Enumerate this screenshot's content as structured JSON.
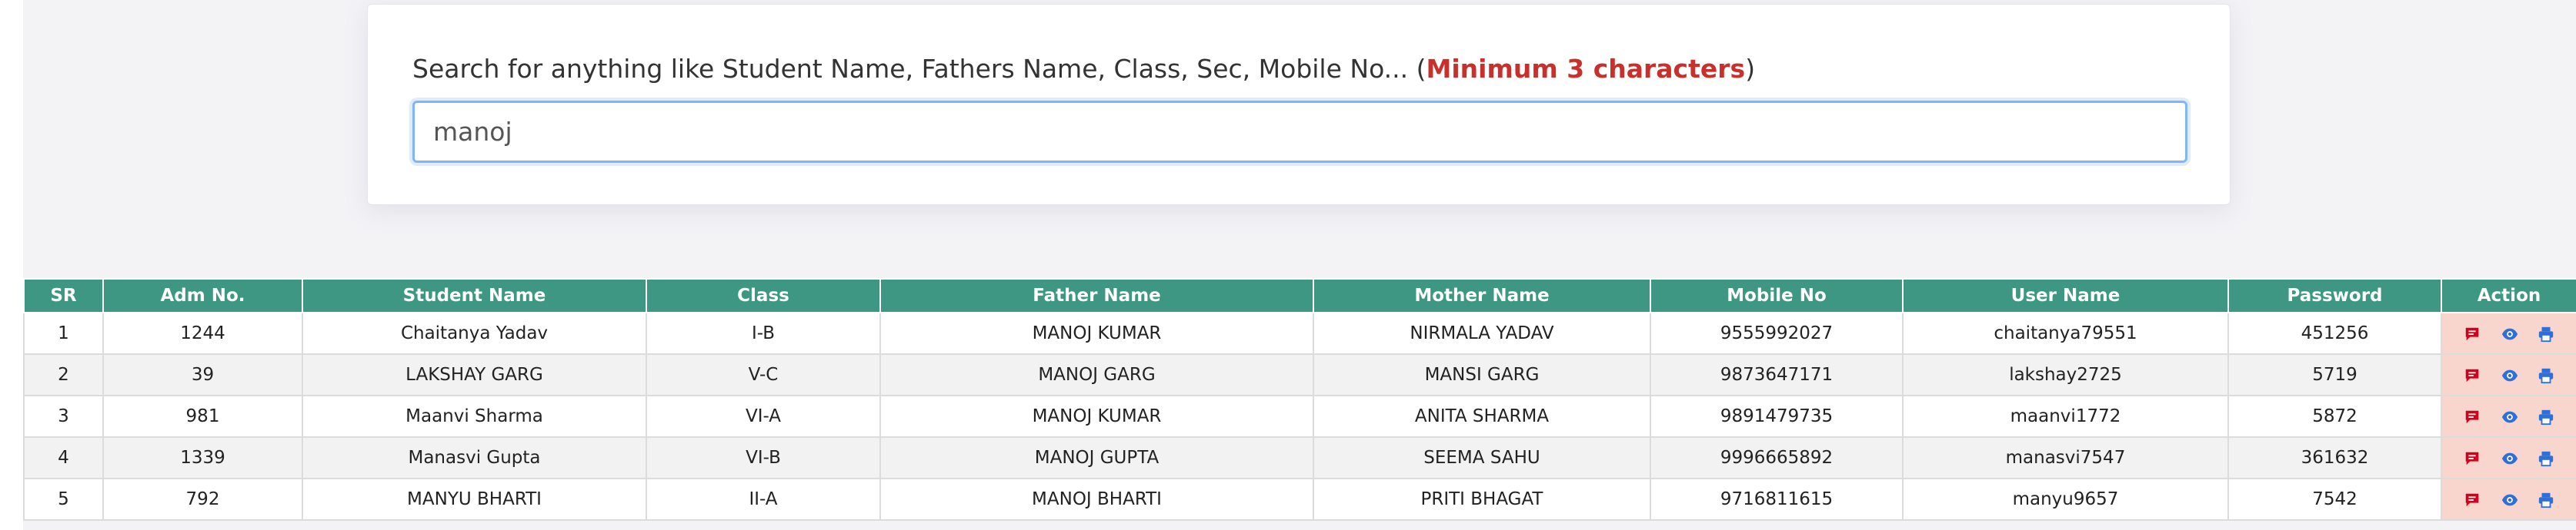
{
  "search": {
    "label_prefix": "Search for anything like Student Name, Fathers Name, Class, Sec, Mobile No... (",
    "label_hint": "Minimum 3 characters",
    "label_suffix": ")",
    "value": "manoj"
  },
  "table": {
    "headers": {
      "sr": "SR",
      "adm": "Adm No.",
      "student": "Student Name",
      "class": "Class",
      "father": "Father Name",
      "mother": "Mother Name",
      "mobile": "Mobile No",
      "username": "User Name",
      "password": "Password",
      "action": "Action"
    },
    "rows": [
      {
        "sr": "1",
        "adm": "1244",
        "student": "Chaitanya Yadav",
        "class": "I-B",
        "father": "MANOJ KUMAR",
        "mother": "NIRMALA YADAV",
        "mobile": "9555992027",
        "username": "chaitanya79551",
        "password": "451256"
      },
      {
        "sr": "2",
        "adm": "39",
        "student": "LAKSHAY GARG",
        "class": "V-C",
        "father": "MANOJ GARG",
        "mother": "MANSI GARG",
        "mobile": "9873647171",
        "username": "lakshay2725",
        "password": "5719"
      },
      {
        "sr": "3",
        "adm": "981",
        "student": "Maanvi Sharma",
        "class": "VI-A",
        "father": "MANOJ KUMAR",
        "mother": "ANITA SHARMA",
        "mobile": "9891479735",
        "username": "maanvi1772",
        "password": "5872"
      },
      {
        "sr": "4",
        "adm": "1339",
        "student": "Manasvi Gupta",
        "class": "VI-B",
        "father": "MANOJ GUPTA",
        "mother": "SEEMA SAHU",
        "mobile": "9996665892",
        "username": "manasvi7547",
        "password": "361632"
      },
      {
        "sr": "5",
        "adm": "792",
        "student": "MANYU BHARTI",
        "class": "II-A",
        "father": "MANOJ BHARTI",
        "mother": "PRITI BHAGAT",
        "mobile": "9716811615",
        "username": "manyu9657",
        "password": "7542"
      }
    ],
    "action_icons": [
      "message-icon",
      "eye-icon",
      "print-icon"
    ]
  },
  "colors": {
    "header_bg": "#3e9782",
    "hint_red": "#c9302c",
    "action_bg": "#f8d5cd",
    "message_icon": "#d0021b",
    "eye_icon": "#2f6fd6",
    "print_icon": "#2f6fd6"
  }
}
